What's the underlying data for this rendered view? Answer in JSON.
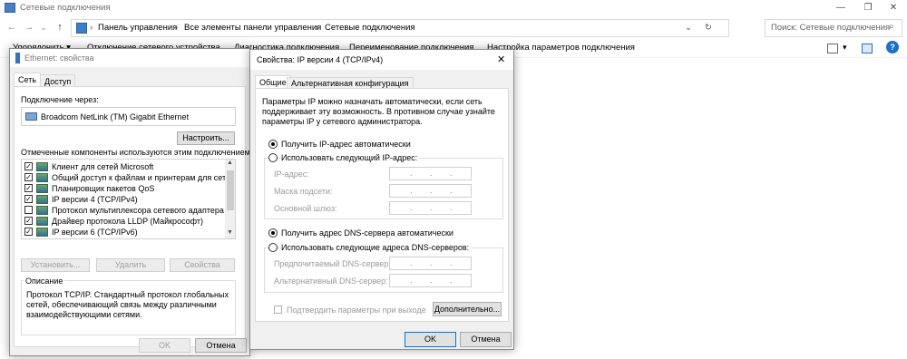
{
  "explorer": {
    "title": "Сетевые подключения",
    "caption_buttons": {
      "minimize": "—",
      "restore": "❐",
      "close": "✕"
    },
    "nav": {
      "back": "←",
      "forward": "→",
      "down": "⌄",
      "up": "↑"
    },
    "breadcrumb": [
      "Панель управления",
      "Все элементы панели управления",
      "Сетевые подключения"
    ],
    "breadcrumb_separator": "›",
    "search_placeholder": "Поиск: Сетевые подключения",
    "commands": [
      "Упорядочить ▾",
      "Отключение сетевого устройства",
      "Диагностика подключения",
      "Переименование подключения",
      "Настройка параметров подключения"
    ]
  },
  "ethernet_dialog": {
    "title": "Ethernet: свойства",
    "tabs": [
      "Сеть",
      "Доступ"
    ],
    "connect_via_label": "Подключение через:",
    "adapter_name": "Broadcom NetLink (TM) Gigabit Ethernet",
    "configure_button": "Настроить...",
    "components_label": "Отмеченные компоненты используются этим подключением:",
    "components": [
      {
        "checked": true,
        "label": "Клиент для сетей Microsoft"
      },
      {
        "checked": true,
        "label": "Общий доступ к файлам и принтерам для сетей Mi"
      },
      {
        "checked": true,
        "label": "Планировщик пакетов QoS"
      },
      {
        "checked": true,
        "label": "IP версии 4 (TCP/IPv4)"
      },
      {
        "checked": false,
        "label": "Протокол мультиплексора сетевого адаптера (Ма"
      },
      {
        "checked": true,
        "label": "Драйвер протокола LLDP (Майкрософт)"
      },
      {
        "checked": true,
        "label": "IP версии 6 (TCP/IPv6)"
      }
    ],
    "buttons": {
      "install": "Установить...",
      "remove": "Удалить",
      "properties": "Свойства"
    },
    "description_label": "Описание",
    "description_text": "Протокол TCP/IP. Стандартный протокол глобальных сетей, обеспечивающий связь между различными взаимодействующими сетями.",
    "ok": "OK",
    "cancel": "Отмена"
  },
  "ipv4_dialog": {
    "title": "Свойства: IP версии 4 (TCP/IPv4)",
    "close": "✕",
    "tabs": [
      "Общие",
      "Альтернативная конфигурация"
    ],
    "intro": "Параметры IP можно назначать автоматически, если сеть поддерживает эту возможность. В противном случае узнайте параметры IP у сетевого администратора.",
    "radio_ip_auto": "Получить IP-адрес автоматически",
    "radio_ip_manual": "Использовать следующий IP-адрес:",
    "ip_label": "IP-адрес:",
    "mask_label": "Маска подсети:",
    "gateway_label": "Основной шлюз:",
    "radio_dns_auto": "Получить адрес DNS-сервера автоматически",
    "radio_dns_manual": "Использовать следующие адреса DNS-серверов:",
    "dns_pref_label": "Предпочитаемый DNS-сервер:",
    "dns_alt_label": "Альтернативный DNS-сервер:",
    "validate_label": "Подтвердить параметры при выходе",
    "advanced_button": "Дополнительно...",
    "ok": "OK",
    "cancel": "Отмена",
    "ip_dot": "."
  }
}
